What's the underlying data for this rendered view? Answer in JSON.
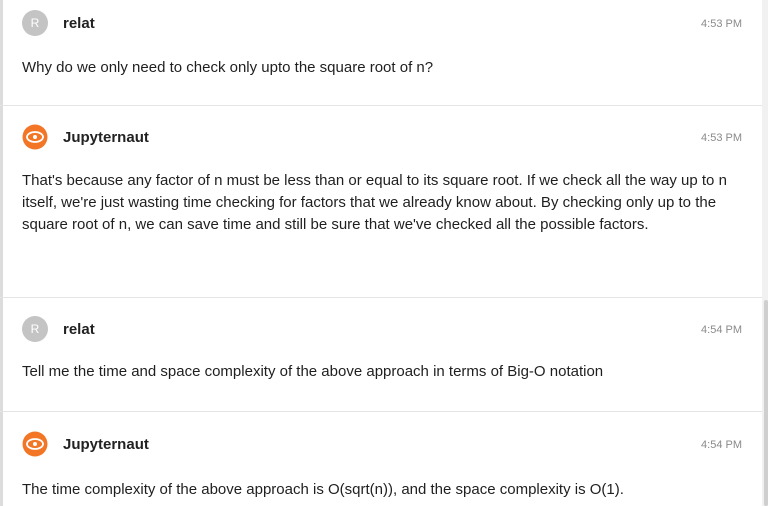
{
  "colors": {
    "user_avatar": "#c4c4c4",
    "bot_avatar": "#f37626",
    "timestamp": "#8a8a8a",
    "divider": "#e4e4e4"
  },
  "messages": [
    {
      "role": "user",
      "avatar_letter": "R",
      "author": "relat",
      "time": "4:53 PM",
      "text": "Why do we only need to check only upto the square root of n?"
    },
    {
      "role": "assistant",
      "avatar_icon": "jupyter-logo-icon",
      "author": "Jupyternaut",
      "time": "4:53 PM",
      "text": "That's because any factor of n must be less than or equal to its square root. If we check all the way up to n itself, we're just wasting time checking for factors that we already know about. By checking only up to the square root of n, we can save time and still be sure that we've checked all the possible factors."
    },
    {
      "role": "user",
      "avatar_letter": "R",
      "author": "relat",
      "time": "4:54 PM",
      "text": "Tell me the time and space complexity of the above approach in terms of Big-O notation"
    },
    {
      "role": "assistant",
      "avatar_icon": "jupyter-logo-icon",
      "author": "Jupyternaut",
      "time": "4:54 PM",
      "text": "The time complexity of the above approach is O(sqrt(n)), and the space complexity is O(1)."
    }
  ]
}
